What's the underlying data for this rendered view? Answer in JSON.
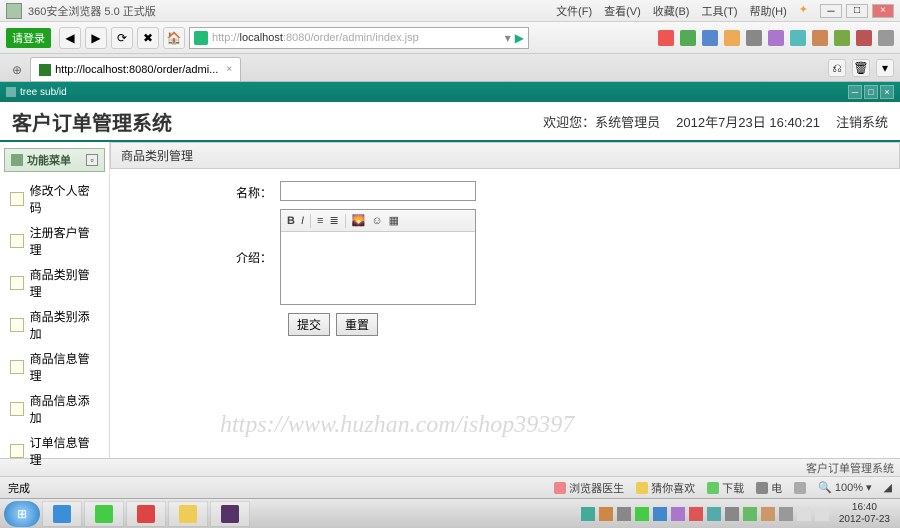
{
  "browser": {
    "title": "360安全浏览器 5.0 正式版",
    "menus": [
      "文件(F)",
      "查看(V)",
      "收藏(B)",
      "工具(T)",
      "帮助(H)"
    ],
    "login_tag": "请登录",
    "url_scheme": "http://",
    "url_host": "localhost",
    "url_rest": ":8080/order/admin/index.jsp",
    "tab_label": "http://localhost:8080/order/admi..."
  },
  "app_bar": {
    "title": "tree sub/id"
  },
  "header": {
    "title": "客户订单管理系统",
    "welcome": "欢迎您：系统管理员",
    "datetime": "2012年7月23日  16:40:21",
    "logout": "注销系统"
  },
  "sidebar": {
    "head": "功能菜单",
    "items": [
      {
        "label": "修改个人密码"
      },
      {
        "label": "注册客户管理"
      },
      {
        "label": "商品类别管理"
      },
      {
        "label": "商品类别添加"
      },
      {
        "label": "商品信息管理"
      },
      {
        "label": "商品信息添加"
      },
      {
        "label": "订单信息管理"
      }
    ]
  },
  "main": {
    "crumb": "商品类别管理",
    "label_name": "名称：",
    "label_desc": "介绍：",
    "btn_submit": "提交",
    "btn_reset": "重置"
  },
  "bottom_status": {
    "right": "客户订单管理系统"
  },
  "browser_status": {
    "done": "完成",
    "items": [
      "浏览器医生",
      "猜你喜欢",
      "下载",
      "电"
    ],
    "zoom": "100%"
  },
  "watermark": "https://www.huzhan.com/ishop39397",
  "clock": {
    "time": "16:40",
    "date": "2012-07-23"
  }
}
